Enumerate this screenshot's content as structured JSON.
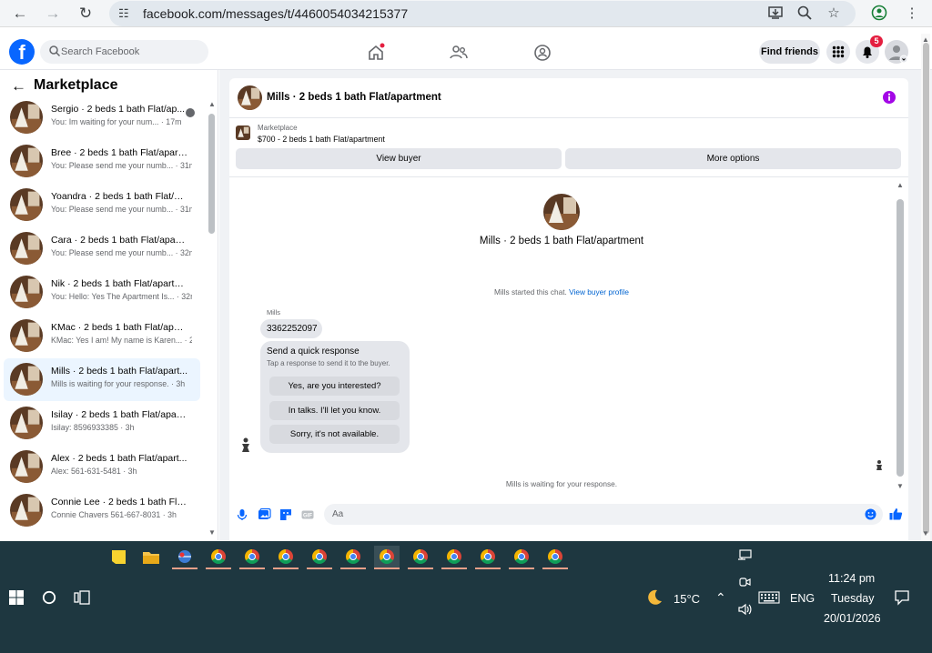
{
  "browser": {
    "url": "facebook.com/messages/t/4460054034215377"
  },
  "header": {
    "search_placeholder": "Search Facebook",
    "find_friends": "Find friends",
    "notification_count": "5"
  },
  "sidebar": {
    "title": "Marketplace",
    "conversations": [
      {
        "name": "Sergio · 2 beds 1 bath Flat/ap...",
        "preview": "You: Im waiting for your num... · 17m",
        "active": false
      },
      {
        "name": "Bree · 2 beds 1 bath Flat/apart...",
        "preview": "You: Please send me your numb... · 31m",
        "active": false
      },
      {
        "name": "Yoandra · 2 beds 1 bath Flat/ap...",
        "preview": "You: Please send me your numb... · 31m",
        "active": false
      },
      {
        "name": "Cara · 2 beds 1 bath Flat/apart...",
        "preview": "You: Please send me your numb... · 32m",
        "active": false
      },
      {
        "name": "Nik · 2 beds 1 bath Flat/apartm...",
        "preview": "You: Hello: Yes The Apartment Is... · 32m",
        "active": false
      },
      {
        "name": "KMac · 2 beds 1 bath Flat/apart...",
        "preview": "KMac: Yes I am! My name is Karen... · 2h",
        "active": false
      },
      {
        "name": "Mills · 2 beds 1 bath Flat/apart...",
        "preview": "Mills is waiting for your response. · 3h",
        "active": true
      },
      {
        "name": "Isilay · 2 beds 1 bath Flat/apart...",
        "preview": "Isilay: 8596933385 · 3h",
        "active": false
      },
      {
        "name": "Alex · 2 beds 1 bath Flat/apart...",
        "preview": "Alex: 561-631-5481 · 3h",
        "active": false
      },
      {
        "name": "Connie Lee · 2 beds 1 bath Flat/...",
        "preview": "Connie Chavers 561-667-8031 · 3h",
        "active": false
      }
    ]
  },
  "chat": {
    "title": "Mills · 2 beds 1 bath Flat/apartment",
    "marketplace_label": "Marketplace",
    "listing": "$700 - 2 beds 1 bath Flat/apartment",
    "view_buyer": "View buyer",
    "more_options": "More options",
    "center_title": "Mills · 2 beds 1 bath Flat/apartment",
    "system_message": "Mills started this chat.",
    "view_buyer_profile": "View buyer profile",
    "sender": "Mills",
    "phone_message": "3362252097",
    "quick_response_title": "Send a quick response",
    "quick_response_sub": "Tap a response to send it to the buyer.",
    "quick_responses": [
      "Yes, are you interested?",
      "In talks. I'll let you know.",
      "Sorry, it's not available."
    ],
    "waiting": "Mills is waiting for your response.",
    "composer_placeholder": "Aa"
  },
  "taskbar": {
    "weather": "15°C",
    "language": "ENG",
    "time": "11:24 pm",
    "day": "Tuesday",
    "date": "20/01/2026"
  },
  "colors": {
    "brand": "#0866ff",
    "taskbar": "#1e3740",
    "active_conv": "#ebf5ff",
    "badge": "#e41e3f",
    "info": "#a307e6"
  }
}
